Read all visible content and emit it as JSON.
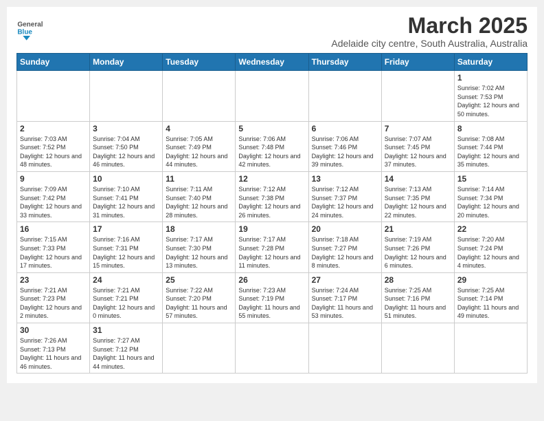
{
  "header": {
    "logo_general": "General",
    "logo_blue": "Blue",
    "title": "March 2025",
    "subtitle": "Adelaide city centre, South Australia, Australia"
  },
  "days_of_week": [
    "Sunday",
    "Monday",
    "Tuesday",
    "Wednesday",
    "Thursday",
    "Friday",
    "Saturday"
  ],
  "weeks": [
    [
      {
        "day": "",
        "info": ""
      },
      {
        "day": "",
        "info": ""
      },
      {
        "day": "",
        "info": ""
      },
      {
        "day": "",
        "info": ""
      },
      {
        "day": "",
        "info": ""
      },
      {
        "day": "",
        "info": ""
      },
      {
        "day": "1",
        "info": "Sunrise: 7:02 AM\nSunset: 7:53 PM\nDaylight: 12 hours and 50 minutes."
      }
    ],
    [
      {
        "day": "2",
        "info": "Sunrise: 7:03 AM\nSunset: 7:52 PM\nDaylight: 12 hours and 48 minutes."
      },
      {
        "day": "3",
        "info": "Sunrise: 7:04 AM\nSunset: 7:50 PM\nDaylight: 12 hours and 46 minutes."
      },
      {
        "day": "4",
        "info": "Sunrise: 7:05 AM\nSunset: 7:49 PM\nDaylight: 12 hours and 44 minutes."
      },
      {
        "day": "5",
        "info": "Sunrise: 7:06 AM\nSunset: 7:48 PM\nDaylight: 12 hours and 42 minutes."
      },
      {
        "day": "6",
        "info": "Sunrise: 7:06 AM\nSunset: 7:46 PM\nDaylight: 12 hours and 39 minutes."
      },
      {
        "day": "7",
        "info": "Sunrise: 7:07 AM\nSunset: 7:45 PM\nDaylight: 12 hours and 37 minutes."
      },
      {
        "day": "8",
        "info": "Sunrise: 7:08 AM\nSunset: 7:44 PM\nDaylight: 12 hours and 35 minutes."
      }
    ],
    [
      {
        "day": "9",
        "info": "Sunrise: 7:09 AM\nSunset: 7:42 PM\nDaylight: 12 hours and 33 minutes."
      },
      {
        "day": "10",
        "info": "Sunrise: 7:10 AM\nSunset: 7:41 PM\nDaylight: 12 hours and 31 minutes."
      },
      {
        "day": "11",
        "info": "Sunrise: 7:11 AM\nSunset: 7:40 PM\nDaylight: 12 hours and 28 minutes."
      },
      {
        "day": "12",
        "info": "Sunrise: 7:12 AM\nSunset: 7:38 PM\nDaylight: 12 hours and 26 minutes."
      },
      {
        "day": "13",
        "info": "Sunrise: 7:12 AM\nSunset: 7:37 PM\nDaylight: 12 hours and 24 minutes."
      },
      {
        "day": "14",
        "info": "Sunrise: 7:13 AM\nSunset: 7:35 PM\nDaylight: 12 hours and 22 minutes."
      },
      {
        "day": "15",
        "info": "Sunrise: 7:14 AM\nSunset: 7:34 PM\nDaylight: 12 hours and 20 minutes."
      }
    ],
    [
      {
        "day": "16",
        "info": "Sunrise: 7:15 AM\nSunset: 7:33 PM\nDaylight: 12 hours and 17 minutes."
      },
      {
        "day": "17",
        "info": "Sunrise: 7:16 AM\nSunset: 7:31 PM\nDaylight: 12 hours and 15 minutes."
      },
      {
        "day": "18",
        "info": "Sunrise: 7:17 AM\nSunset: 7:30 PM\nDaylight: 12 hours and 13 minutes."
      },
      {
        "day": "19",
        "info": "Sunrise: 7:17 AM\nSunset: 7:28 PM\nDaylight: 12 hours and 11 minutes."
      },
      {
        "day": "20",
        "info": "Sunrise: 7:18 AM\nSunset: 7:27 PM\nDaylight: 12 hours and 8 minutes."
      },
      {
        "day": "21",
        "info": "Sunrise: 7:19 AM\nSunset: 7:26 PM\nDaylight: 12 hours and 6 minutes."
      },
      {
        "day": "22",
        "info": "Sunrise: 7:20 AM\nSunset: 7:24 PM\nDaylight: 12 hours and 4 minutes."
      }
    ],
    [
      {
        "day": "23",
        "info": "Sunrise: 7:21 AM\nSunset: 7:23 PM\nDaylight: 12 hours and 2 minutes."
      },
      {
        "day": "24",
        "info": "Sunrise: 7:21 AM\nSunset: 7:21 PM\nDaylight: 12 hours and 0 minutes."
      },
      {
        "day": "25",
        "info": "Sunrise: 7:22 AM\nSunset: 7:20 PM\nDaylight: 11 hours and 57 minutes."
      },
      {
        "day": "26",
        "info": "Sunrise: 7:23 AM\nSunset: 7:19 PM\nDaylight: 11 hours and 55 minutes."
      },
      {
        "day": "27",
        "info": "Sunrise: 7:24 AM\nSunset: 7:17 PM\nDaylight: 11 hours and 53 minutes."
      },
      {
        "day": "28",
        "info": "Sunrise: 7:25 AM\nSunset: 7:16 PM\nDaylight: 11 hours and 51 minutes."
      },
      {
        "day": "29",
        "info": "Sunrise: 7:25 AM\nSunset: 7:14 PM\nDaylight: 11 hours and 49 minutes."
      }
    ],
    [
      {
        "day": "30",
        "info": "Sunrise: 7:26 AM\nSunset: 7:13 PM\nDaylight: 11 hours and 46 minutes."
      },
      {
        "day": "31",
        "info": "Sunrise: 7:27 AM\nSunset: 7:12 PM\nDaylight: 11 hours and 44 minutes."
      },
      {
        "day": "",
        "info": ""
      },
      {
        "day": "",
        "info": ""
      },
      {
        "day": "",
        "info": ""
      },
      {
        "day": "",
        "info": ""
      },
      {
        "day": "",
        "info": ""
      }
    ]
  ]
}
